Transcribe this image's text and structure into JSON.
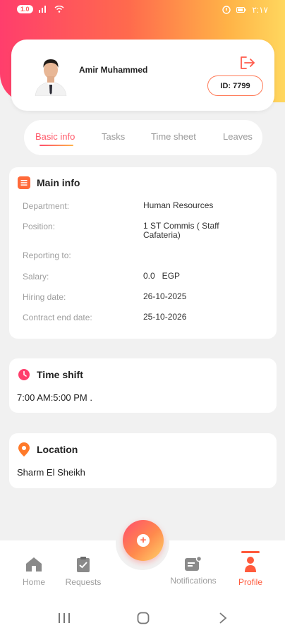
{
  "status_bar": {
    "pill_text": "1.0",
    "right_text": "٢:١٧"
  },
  "profile": {
    "name": "Amir Muhammed",
    "id_text": "ID: 7799"
  },
  "tabs": [
    {
      "label": "Basic info",
      "active": true
    },
    {
      "label": "Tasks",
      "active": false
    },
    {
      "label": "Time sheet",
      "active": false
    },
    {
      "label": "Leaves",
      "active": false
    }
  ],
  "main_info": {
    "title": "Main info",
    "rows": [
      {
        "label": "Department:",
        "value": "Human Resources"
      },
      {
        "label": "Position:",
        "value": "1 ST Commis ( Staff Cafateria)"
      },
      {
        "label": "Reporting to:",
        "value": ""
      },
      {
        "label": "Salary:",
        "value": "0.0   EGP"
      },
      {
        "label": "Hiring date:",
        "value": "26-10-2025"
      },
      {
        "label": "Contract end date:",
        "value": "25-10-2026"
      }
    ]
  },
  "time_shift": {
    "title": "Time shift",
    "value": "7:00 AM:5:00 PM ."
  },
  "location": {
    "title": "Location",
    "value": "Sharm El Sheikh"
  },
  "bottom_nav": {
    "items": [
      {
        "label": "Home",
        "icon": "home-icon"
      },
      {
        "label": "Requests",
        "icon": "clipboard-icon"
      },
      {
        "label": "Notifications",
        "icon": "notifications-icon"
      },
      {
        "label": "Profile",
        "icon": "person-icon",
        "active": true
      }
    ],
    "fab_icon": "+"
  },
  "colors": {
    "accent": "#ff5a3c",
    "gradient_start": "#ff3e6c",
    "gradient_end": "#ffd75e",
    "location_pin": "#ff7a2a"
  }
}
